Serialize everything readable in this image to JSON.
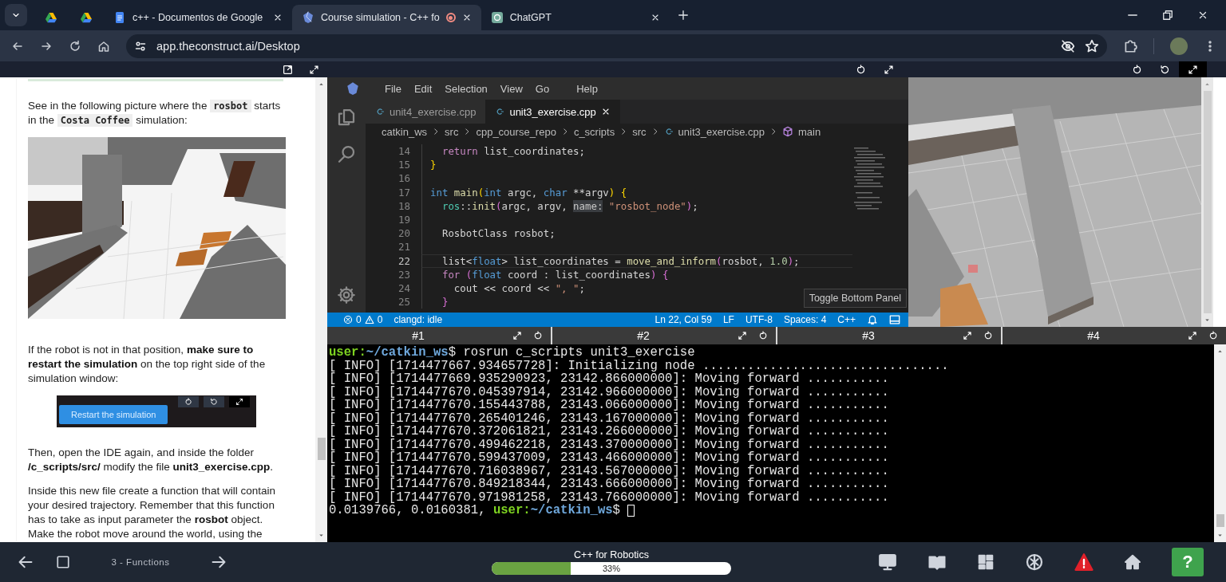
{
  "browser": {
    "tabs": [
      {
        "kind": "drive",
        "selected": false,
        "recording": false
      },
      {
        "kind": "drive",
        "selected": false,
        "recording": false
      },
      {
        "kind": "docs",
        "title": "c++ - Documentos de Google",
        "selected": false,
        "recording": false
      },
      {
        "kind": "construct",
        "title": "Course simulation - C++ fo",
        "selected": true,
        "recording": true
      },
      {
        "kind": "chatgpt",
        "title": "ChatGPT",
        "selected": false,
        "recording": false
      }
    ],
    "url": "app.theconstruct.ai/Desktop"
  },
  "lesson_panel": {
    "blocks": [
      {
        "kind": "paragraph",
        "segments": [
          {
            "kind": "text",
            "text": "See in the following picture where the "
          },
          {
            "kind": "code",
            "text": "rosbot"
          },
          {
            "kind": "text",
            "text": " starts in the "
          },
          {
            "kind": "code",
            "text": "Costa Coffee"
          },
          {
            "kind": "text",
            "text": " simulation:"
          }
        ]
      },
      {
        "kind": "image"
      },
      {
        "kind": "paragraph",
        "segments": [
          {
            "kind": "text",
            "text": "If the robot is not in that position, "
          },
          {
            "kind": "bold",
            "text": "make sure to restart the simulation"
          },
          {
            "kind": "text",
            "text": " on the top right side of the simulation window:"
          }
        ]
      },
      {
        "kind": "banner",
        "button_label": "Restart the simulation"
      },
      {
        "kind": "paragraph",
        "segments": [
          {
            "kind": "text",
            "text": "Then, open the IDE again, and inside the folder "
          },
          {
            "kind": "bold",
            "text": "/c_scripts/src/"
          },
          {
            "kind": "text",
            "text": " modify the file "
          },
          {
            "kind": "bold",
            "text": "unit3_exercise.cpp"
          },
          {
            "kind": "text",
            "text": "."
          }
        ]
      },
      {
        "kind": "paragraph",
        "segments": [
          {
            "kind": "text",
            "text": "Inside this new file create a function that will contain your desired trajectory. Remember that this function has to take as input parameter the "
          },
          {
            "kind": "bold",
            "text": "rosbot"
          },
          {
            "kind": "text",
            "text": " object. Make the robot move around the world, using the"
          }
        ]
      }
    ]
  },
  "ide": {
    "menu": [
      "File",
      "Edit",
      "Selection",
      "View",
      "Go",
      "Help"
    ],
    "tabs": [
      {
        "label": "unit4_exercise.cpp",
        "selected": false
      },
      {
        "label": "unit3_exercise.cpp",
        "selected": true
      }
    ],
    "breadcrumbs": [
      {
        "kind": "folder",
        "label": "catkin_ws"
      },
      {
        "kind": "folder",
        "label": "src"
      },
      {
        "kind": "folder",
        "label": "cpp_course_repo"
      },
      {
        "kind": "folder",
        "label": "c_scripts"
      },
      {
        "kind": "folder",
        "label": "src"
      },
      {
        "kind": "file",
        "label": "unit3_exercise.cpp"
      },
      {
        "kind": "symbol",
        "label": "main"
      }
    ],
    "lines": [
      {
        "number": "14",
        "current": false,
        "tokens": [
          {
            "kind": "keyword",
            "text": "  return"
          },
          {
            "kind": "plain",
            "text": " list_coordinates;"
          }
        ]
      },
      {
        "number": "15",
        "current": false,
        "tokens": [
          {
            "kind": "bracket",
            "text": "}"
          }
        ]
      },
      {
        "number": "16",
        "current": false
      },
      {
        "number": "17",
        "current": false,
        "tokens": [
          {
            "kind": "type",
            "text": "int "
          },
          {
            "kind": "function",
            "text": "main"
          },
          {
            "kind": "bracket",
            "text": "("
          },
          {
            "kind": "type",
            "text": "int"
          },
          {
            "kind": "plain",
            "text": " argc, "
          },
          {
            "kind": "type",
            "text": "char"
          },
          {
            "kind": "plain",
            "text": " **argv"
          },
          {
            "kind": "bracket",
            "text": ") {"
          }
        ]
      },
      {
        "number": "18",
        "current": false,
        "tokens": [
          {
            "kind": "namespace",
            "text": "  ros"
          },
          {
            "kind": "plain",
            "text": "::"
          },
          {
            "kind": "function",
            "text": "init"
          },
          {
            "kind": "bracket2",
            "text": "("
          },
          {
            "kind": "plain",
            "text": "argc, argv, "
          },
          {
            "kind": "hint",
            "text": "name:"
          },
          {
            "kind": "string",
            "text": " \"rosbot_node\""
          },
          {
            "kind": "bracket2",
            "text": ")"
          },
          {
            "kind": "plain",
            "text": ";"
          }
        ]
      },
      {
        "number": "19",
        "current": false
      },
      {
        "number": "20",
        "current": false,
        "tokens": [
          {
            "kind": "plain",
            "text": "  RosbotClass rosbot;"
          }
        ]
      },
      {
        "number": "21",
        "current": false
      },
      {
        "number": "22",
        "current": true,
        "tokens": [
          {
            "kind": "plain",
            "text": "  list<"
          },
          {
            "kind": "type",
            "text": "float"
          },
          {
            "kind": "plain",
            "text": "> list_coordinates = "
          },
          {
            "kind": "function",
            "text": "move_and_inform"
          },
          {
            "kind": "bracket2",
            "text": "("
          },
          {
            "kind": "plain",
            "text": "rosbot, "
          },
          {
            "kind": "number",
            "text": "1.0"
          },
          {
            "kind": "bracket2",
            "text": ")"
          },
          {
            "kind": "plain",
            "text": ";"
          }
        ]
      },
      {
        "number": "23",
        "current": false,
        "tokens": [
          {
            "kind": "keyword",
            "text": "  for "
          },
          {
            "kind": "bracket2",
            "text": "("
          },
          {
            "kind": "type",
            "text": "float"
          },
          {
            "kind": "plain",
            "text": " coord : list_coordinates"
          },
          {
            "kind": "bracket2",
            "text": ") {"
          }
        ]
      },
      {
        "number": "24",
        "current": false,
        "tokens": [
          {
            "kind": "plain",
            "text": "    cout << coord << "
          },
          {
            "kind": "string",
            "text": "\", \""
          },
          {
            "kind": "plain",
            "text": ";"
          }
        ]
      },
      {
        "number": "25",
        "current": false,
        "tokens": [
          {
            "kind": "bracket2",
            "text": "  }"
          }
        ]
      }
    ],
    "status": {
      "errors": "0",
      "warnings": "0",
      "language_server": "clangd: idle",
      "cursor": "Ln 22, Col 59",
      "eol": "LF",
      "encoding": "UTF-8",
      "indent": "Spaces: 4",
      "language": "C++"
    },
    "tooltip": "Toggle Bottom Panel"
  },
  "terminal": {
    "tabs": [
      {
        "label": "#1"
      },
      {
        "label": "#2"
      },
      {
        "label": "#3"
      },
      {
        "label": "#4"
      }
    ],
    "lines": [
      {
        "cursor": false,
        "segments": [
          {
            "kind": "user",
            "text": "user:"
          },
          {
            "kind": "path",
            "text": "~/catkin_ws"
          },
          {
            "kind": "plain",
            "text": "$ rosrun c_scripts unit3_exercise"
          }
        ]
      },
      {
        "cursor": false,
        "segments": [
          {
            "kind": "plain",
            "text": "[ INFO] [1714477667.934657728]: Initializing node ................................."
          }
        ]
      },
      {
        "cursor": false,
        "segments": [
          {
            "kind": "plain",
            "text": "[ INFO] [1714477669.935290923, 23142.866000000]: Moving forward ..........."
          }
        ]
      },
      {
        "cursor": false,
        "segments": [
          {
            "kind": "plain",
            "text": "[ INFO] [1714477670.045397914, 23142.966000000]: Moving forward ..........."
          }
        ]
      },
      {
        "cursor": false,
        "segments": [
          {
            "kind": "plain",
            "text": "[ INFO] [1714477670.155443788, 23143.066000000]: Moving forward ..........."
          }
        ]
      },
      {
        "cursor": false,
        "segments": [
          {
            "kind": "plain",
            "text": "[ INFO] [1714477670.265401246, 23143.167000000]: Moving forward ..........."
          }
        ]
      },
      {
        "cursor": false,
        "segments": [
          {
            "kind": "plain",
            "text": "[ INFO] [1714477670.372061821, 23143.266000000]: Moving forward ..........."
          }
        ]
      },
      {
        "cursor": false,
        "segments": [
          {
            "kind": "plain",
            "text": "[ INFO] [1714477670.499462218, 23143.370000000]: Moving forward ..........."
          }
        ]
      },
      {
        "cursor": false,
        "segments": [
          {
            "kind": "plain",
            "text": "[ INFO] [1714477670.599437009, 23143.466000000]: Moving forward ..........."
          }
        ]
      },
      {
        "cursor": false,
        "segments": [
          {
            "kind": "plain",
            "text": "[ INFO] [1714477670.716038967, 23143.567000000]: Moving forward ..........."
          }
        ]
      },
      {
        "cursor": false,
        "segments": [
          {
            "kind": "plain",
            "text": "[ INFO] [1714477670.849218344, 23143.666000000]: Moving forward ..........."
          }
        ]
      },
      {
        "cursor": false,
        "segments": [
          {
            "kind": "plain",
            "text": "[ INFO] [1714477670.971981258, 23143.766000000]: Moving forward ..........."
          }
        ]
      },
      {
        "cursor": true,
        "segments": [
          {
            "kind": "plain",
            "text": "0.0139766, 0.0160381, "
          },
          {
            "kind": "user",
            "text": "user:"
          },
          {
            "kind": "path",
            "text": "~/catkin_ws"
          },
          {
            "kind": "plain",
            "text": "$ "
          }
        ]
      }
    ]
  },
  "bottom_bar": {
    "unit_label": "3 - Functions",
    "course_title": "C++ for Robotics",
    "progress": {
      "level": 0.33,
      "label": "33%"
    },
    "help_label": "?"
  }
}
